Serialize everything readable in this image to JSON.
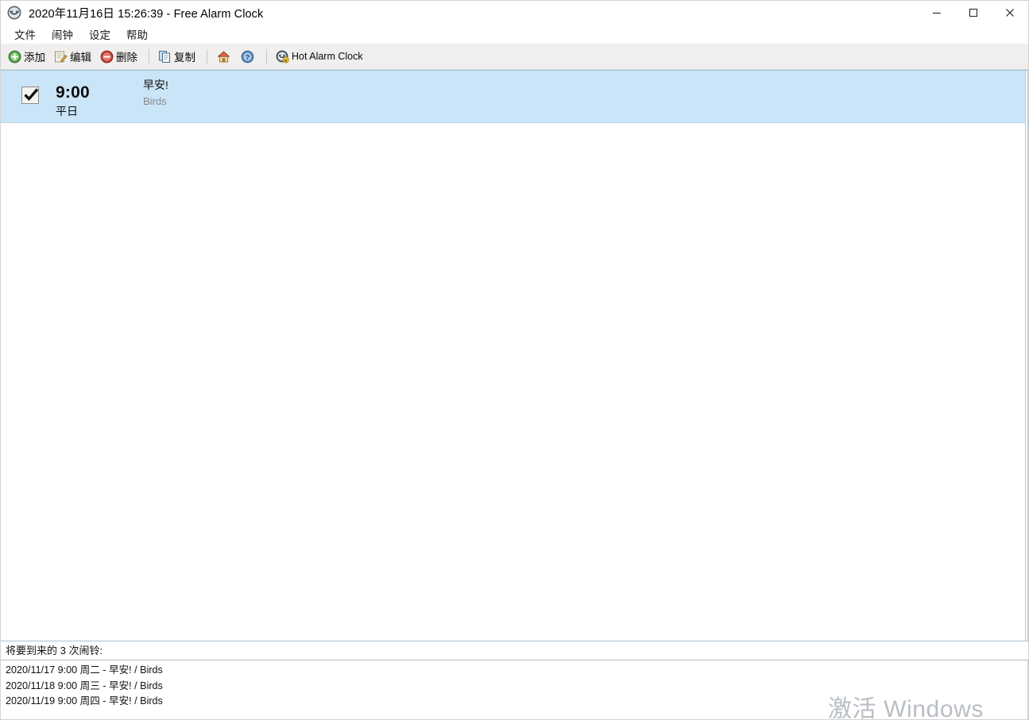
{
  "window": {
    "title": "2020年11月16日 15:26:39 - Free Alarm Clock",
    "app_icon": "alarm-clock-icon",
    "controls": {
      "minimize": "minimize-icon",
      "maximize": "maximize-icon",
      "close": "close-icon"
    }
  },
  "menubar": {
    "items": [
      {
        "label": "文件"
      },
      {
        "label": "闹钟"
      },
      {
        "label": "设定"
      },
      {
        "label": "帮助"
      }
    ]
  },
  "toolbar": {
    "buttons": [
      {
        "label": "添加",
        "icon": "add-circle-icon"
      },
      {
        "label": "编辑",
        "icon": "edit-pencil-icon"
      },
      {
        "label": "删除",
        "icon": "delete-circle-icon"
      },
      {
        "label": "复制",
        "icon": "copy-pages-icon"
      },
      {
        "label": "",
        "icon": "home-icon"
      },
      {
        "label": "",
        "icon": "help-question-icon"
      },
      {
        "label": "Hot Alarm Clock",
        "icon": "hot-alarm-clock-icon"
      }
    ]
  },
  "alarm_list": {
    "rows": [
      {
        "enabled": true,
        "time": "9:00",
        "days": "平日",
        "title": "早安!",
        "sound": "Birds",
        "selected": true
      }
    ]
  },
  "upcoming": {
    "header": "将要到来的 3 次闹铃:",
    "lines": [
      "2020/11/17 9:00 周二 - 早安! / Birds",
      "2020/11/18 9:00 周三 - 早安! / Birds",
      "2020/11/19 9:00 周四 - 早安! / Birds"
    ]
  },
  "watermark": {
    "text": "激活 Windows"
  },
  "colors": {
    "selection": "#cbe5f8",
    "toolbar_bg": "#f1efee",
    "accent_add": "#3f9a3f",
    "accent_delete": "#c0392b"
  }
}
